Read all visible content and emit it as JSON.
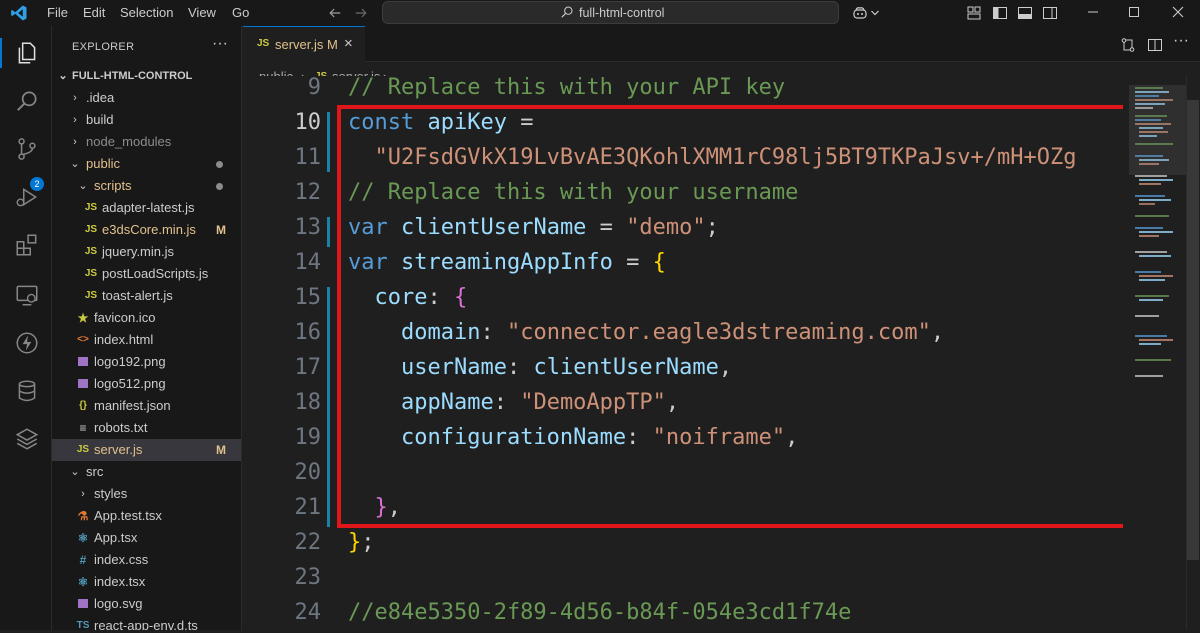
{
  "titlebar": {
    "menu": [
      "File",
      "Edit",
      "Selection",
      "View",
      "Go"
    ],
    "search_text": "full-html-control"
  },
  "activity_badge": "2",
  "explorer": {
    "title": "EXPLORER",
    "more": "···",
    "root": "FULL-HTML-CONTROL",
    "items": [
      {
        "label": ".idea",
        "kind": "folder"
      },
      {
        "label": "build",
        "kind": "folder"
      },
      {
        "label": "node_modules",
        "kind": "folder"
      },
      {
        "label": "public",
        "kind": "folder-open"
      },
      {
        "label": "scripts",
        "kind": "folder-open"
      },
      {
        "label": "adapter-latest.js",
        "kind": "js"
      },
      {
        "label": "e3dsCore.min.js",
        "kind": "js",
        "status": "M"
      },
      {
        "label": "jquery.min.js",
        "kind": "js"
      },
      {
        "label": "postLoadScripts.js",
        "kind": "js"
      },
      {
        "label": "toast-alert.js",
        "kind": "js"
      },
      {
        "label": "favicon.ico",
        "kind": "ico"
      },
      {
        "label": "index.html",
        "kind": "html"
      },
      {
        "label": "logo192.png",
        "kind": "png"
      },
      {
        "label": "logo512.png",
        "kind": "png"
      },
      {
        "label": "manifest.json",
        "kind": "json"
      },
      {
        "label": "robots.txt",
        "kind": "txt"
      },
      {
        "label": "server.js",
        "kind": "js",
        "status": "M"
      },
      {
        "label": "src",
        "kind": "folder-open"
      },
      {
        "label": "styles",
        "kind": "folder"
      },
      {
        "label": "App.test.tsx",
        "kind": "test"
      },
      {
        "label": "App.tsx",
        "kind": "tsx"
      },
      {
        "label": "index.css",
        "kind": "css"
      },
      {
        "label": "index.tsx",
        "kind": "tsx"
      },
      {
        "label": "logo.svg",
        "kind": "svg"
      },
      {
        "label": "react-app-env.d.ts",
        "kind": "ts"
      }
    ]
  },
  "tab": {
    "icon": "JS",
    "name": "server.js",
    "status": "M",
    "close": "×"
  },
  "breadcrumb": {
    "part1": "public",
    "sep": "›",
    "icon": "JS",
    "part2": "server.js",
    "part3": "..."
  },
  "editor": {
    "line_numbers": [
      "9",
      "10",
      "11",
      "12",
      "13",
      "14",
      "15",
      "16",
      "17",
      "18",
      "19",
      "20",
      "21",
      "22",
      "23",
      "24"
    ],
    "code": {
      "l9": "// Replace this with your API key",
      "l10_kw": "const",
      "l10_var": "apiKey",
      "l10_op": " =",
      "l11_str": "\"U2FsdGVkX19LvBvAE3QKohlXMM1rC98lj5BT9TKPaJsv+/mH+OZg",
      "l12": "// Replace this with your username",
      "l13_kw": "var",
      "l13_var": "clientUserName",
      "l13_op": " = ",
      "l13_str": "\"demo\"",
      "l13_end": ";",
      "l14_kw": "var",
      "l14_var": "streamingAppInfo",
      "l14_op": " = ",
      "l14_br": "{",
      "l15_key": "core",
      "l15_colon": ": ",
      "l15_br": "{",
      "l16_key": "domain",
      "l16_colon": ": ",
      "l16_str": "\"connector.eagle3dstreaming.com\"",
      "l16_end": ",",
      "l17_key": "userName",
      "l17_colon": ": ",
      "l17_val": "clientUserName",
      "l17_end": ",",
      "l18_key": "appName",
      "l18_colon": ": ",
      "l18_str": "\"DemoAppTP\"",
      "l18_end": ",",
      "l19_key": "configurationName",
      "l19_colon": ": ",
      "l19_str": "\"noiframe\"",
      "l19_end": ",",
      "l21_br": "}",
      "l21_end": ",",
      "l22_br": "}",
      "l22_end": ";",
      "l24": "//e84e5350-2f89-4d56-b84f-054e3cd1f74e"
    }
  },
  "colors": {
    "accent": "#0078d4",
    "highlight_box": "#e0161b",
    "modified": "#e2c08d"
  }
}
